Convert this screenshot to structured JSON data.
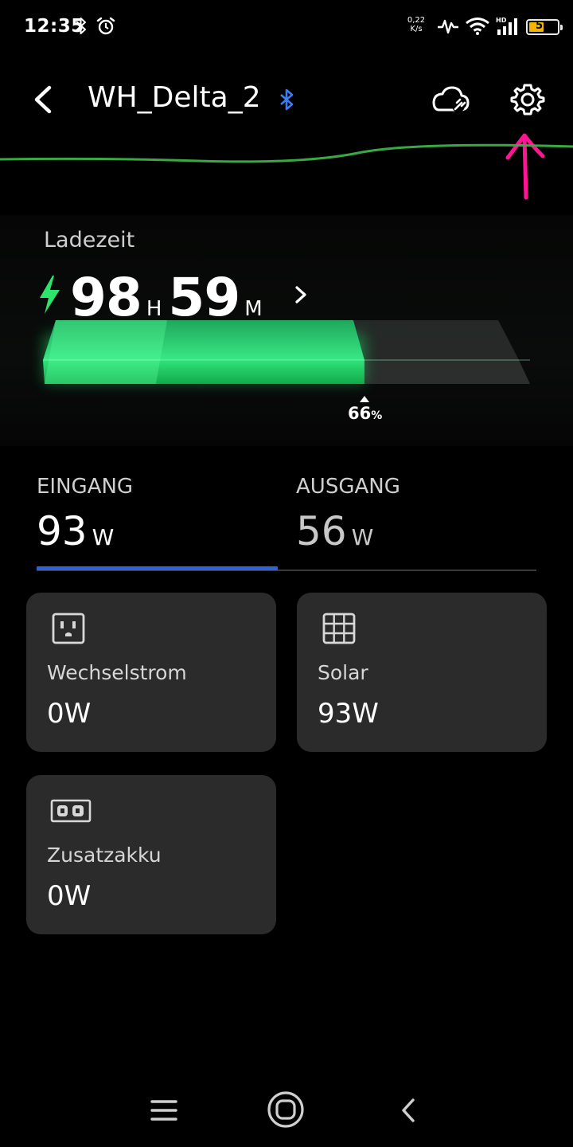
{
  "status_bar": {
    "time": "12:35",
    "net_speed_value": "0,22",
    "net_speed_unit": "K/s",
    "battery_level": "52",
    "battery_fraction": 0.52
  },
  "header": {
    "device_name": "WH_Delta_2",
    "bluetooth_icon": "bluetooth-icon",
    "cloud_icon": "cloud-plug-icon",
    "settings_icon": "gear-icon"
  },
  "charge": {
    "label": "Ladezeit",
    "hours": "98",
    "hours_unit": "H",
    "minutes": "59",
    "minutes_unit": "M",
    "percent_value": "66",
    "percent_unit": "%",
    "percent_fraction": 0.66
  },
  "tabs": [
    {
      "label": "EINGANG",
      "value": "93",
      "unit": "W",
      "active": true
    },
    {
      "label": "AUSGANG",
      "value": "56",
      "unit": "W",
      "active": false
    }
  ],
  "sources": [
    {
      "name": "Wechselstrom",
      "value": "0W",
      "icon": "ac-outlet-icon"
    },
    {
      "name": "Solar",
      "value": "93W",
      "icon": "solar-panel-icon"
    },
    {
      "name": "Zusatzakku",
      "value": "0W",
      "icon": "extra-battery-icon"
    }
  ],
  "colors": {
    "accent_green": "#2de36b",
    "tab_active_blue": "#2f62d6",
    "annotation_pink": "#ff1493",
    "card_bg": "#2b2b2b"
  }
}
